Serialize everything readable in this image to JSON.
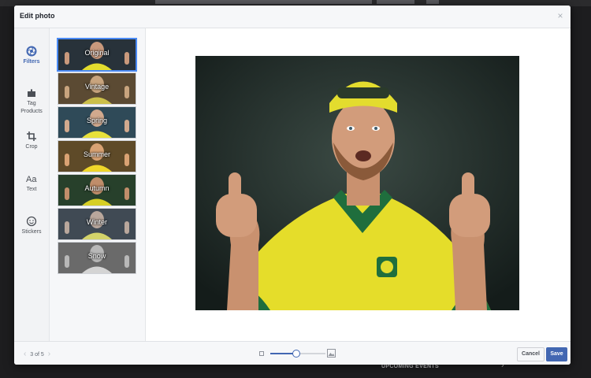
{
  "background": {
    "footer_text": "UPCOMING EVENTS",
    "arrow": "›"
  },
  "modal": {
    "title": "Edit photo",
    "close_glyph": "×"
  },
  "tools": [
    {
      "label": "Filters",
      "icon": "filters-icon",
      "active": true
    },
    {
      "label": "Tag Products",
      "icon": "tag-products-icon",
      "active": false
    },
    {
      "label": "Crop",
      "icon": "crop-icon",
      "active": false
    },
    {
      "label": "Text",
      "icon": "text-icon",
      "active": false
    },
    {
      "label": "Stickers",
      "icon": "stickers-icon",
      "active": false
    }
  ],
  "filters": [
    {
      "label": "Original",
      "tint": "#28323a",
      "selected": true
    },
    {
      "label": "Vintage",
      "tint": "#5b4a33",
      "selected": false
    },
    {
      "label": "Spring",
      "tint": "#2f4a58",
      "selected": false
    },
    {
      "label": "Summer",
      "tint": "#5e4a28",
      "selected": false
    },
    {
      "label": "Autumn",
      "tint": "#27402b",
      "selected": false
    },
    {
      "label": "Winter",
      "tint": "#404a54",
      "selected": false
    },
    {
      "label": "Snow",
      "tint": "#6a6a6a",
      "selected": false
    }
  ],
  "photo": {
    "icon": "photo-preview-icon",
    "jersey_color": "#e5dd2a",
    "accent_color": "#1f6e3d",
    "backdrop_color": "#1e2a27"
  },
  "footer": {
    "pager_text": "3 of 5",
    "prev_glyph": "‹",
    "next_glyph": "›",
    "zoom_level": 0.45,
    "cancel_label": "Cancel",
    "save_label": "Save"
  },
  "colors": {
    "accent": "#4267b2",
    "selected_border": "#4a8af4"
  }
}
